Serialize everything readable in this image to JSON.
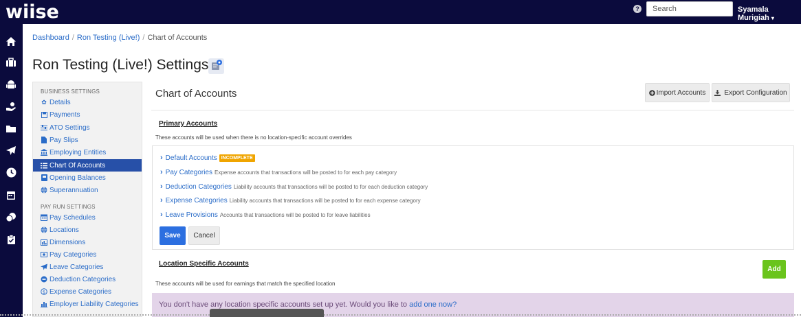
{
  "topbar": {
    "logo": "wiise",
    "help_icon": "?",
    "search_placeholder": "Search",
    "user_name": "Syamala Murigiah"
  },
  "left_nav": [
    "home-icon",
    "briefcase-icon",
    "android-icon",
    "hand-money-icon",
    "folder-icon",
    "plane-icon",
    "clock-icon",
    "calendar-icon",
    "coins-icon",
    "clipboard-check-icon"
  ],
  "breadcrumb": {
    "items": [
      "Dashboard",
      "Ron Testing (Live!)",
      "Chart of Accounts"
    ]
  },
  "page_title": "Ron Testing (Live!) Settings",
  "settings": {
    "business_header": "BUSINESS SETTINGS",
    "business_items": [
      {
        "label": "Details",
        "icon": "gear-icon"
      },
      {
        "label": "Payments",
        "icon": "save-icon"
      },
      {
        "label": "ATO Settings",
        "icon": "sliders-icon"
      },
      {
        "label": "Pay Slips",
        "icon": "file-icon"
      },
      {
        "label": "Employing Entities",
        "icon": "bank-icon"
      },
      {
        "label": "Chart Of Accounts",
        "icon": "list-icon"
      },
      {
        "label": "Opening Balances",
        "icon": "book-icon"
      },
      {
        "label": "Superannuation",
        "icon": "globe-icon"
      }
    ],
    "payrun_header": "PAY RUN SETTINGS",
    "payrun_items": [
      {
        "label": "Pay Schedules",
        "icon": "calendar-icon"
      },
      {
        "label": "Locations",
        "icon": "globe-icon"
      },
      {
        "label": "Dimensions",
        "icon": "bar-chart-icon"
      },
      {
        "label": "Pay Categories",
        "icon": "money-icon"
      },
      {
        "label": "Leave Categories",
        "icon": "plane-icon"
      },
      {
        "label": "Deduction Categories",
        "icon": "minus-circle-icon"
      },
      {
        "label": "Expense Categories",
        "icon": "dollar-circle-icon"
      },
      {
        "label": "Employer Liability Categories",
        "icon": "bar-chart-icon"
      }
    ]
  },
  "panel": {
    "title": "Chart of Accounts",
    "import_label": "Import Accounts",
    "export_label": "Export Configuration",
    "primary_heading": "Primary Accounts",
    "primary_desc": "These accounts will be used when there is no location-specific account overrides",
    "accounts": [
      {
        "label": "Default Accounts",
        "desc": "",
        "badge": "INCOMPLETE"
      },
      {
        "label": "Pay Categories",
        "desc": "Expense accounts that transactions will be posted to for each pay category"
      },
      {
        "label": "Deduction Categories",
        "desc": "Liability accounts that transactions will be posted to for each deduction category"
      },
      {
        "label": "Expense Categories",
        "desc": "Liability accounts that transactions will be posted to for each expense category"
      },
      {
        "label": "Leave Provisions",
        "desc": "Accounts that transactions will be posted to for leave liabilities"
      }
    ],
    "save_label": "Save",
    "cancel_label": "Cancel",
    "location_heading": "Location Specific Accounts",
    "location_desc": "These accounts will be used for earnings that match the specified location",
    "add_label": "Add",
    "info_text": "You don't have any location specific accounts set up yet. Would you like to ",
    "info_link": "add one now?"
  },
  "colors": {
    "nav_bg": "#0b0b3d",
    "link": "#2a6cc8",
    "active_item": "#2750a8",
    "badge": "#f0a500",
    "save": "#2c6fe0",
    "add": "#6ac41c",
    "info_bg": "#e3d4e9"
  }
}
